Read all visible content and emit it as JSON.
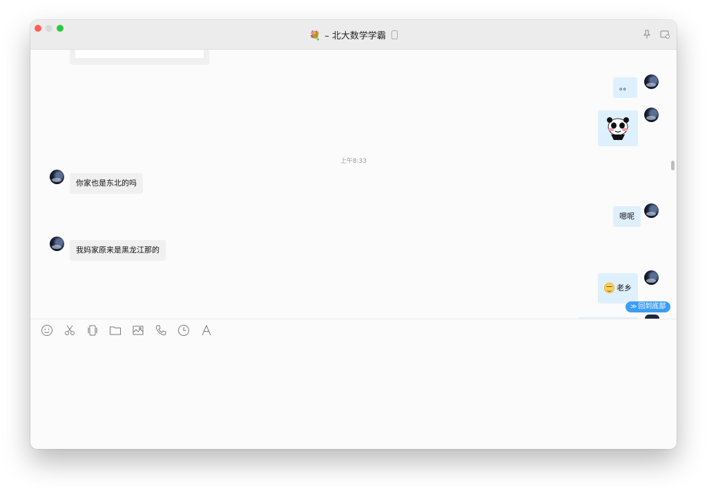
{
  "window": {
    "title_emoji": "💐",
    "title": "– 北大数学学霸"
  },
  "messages": [
    {
      "side": "right",
      "text": "。。"
    },
    {
      "side": "right",
      "type": "sticker",
      "sticker": "panda-sticker"
    },
    {
      "type": "time",
      "text": "上午8:33"
    },
    {
      "side": "left",
      "text": "你家也是东北的吗"
    },
    {
      "side": "right",
      "text": "嗯呢"
    },
    {
      "side": "left",
      "text": "我妈家原来是黑龙江那的"
    },
    {
      "side": "right",
      "emoji": "smile-emoji",
      "text": "老乡"
    }
  ],
  "scroll_to_bottom_label": "回到底部",
  "toolbar": [
    "emoji-icon",
    "scissors-icon",
    "vibrate-icon",
    "folder-icon",
    "image-icon",
    "phone-icon",
    "history-icon",
    "font-icon"
  ],
  "colors": {
    "bubble_self": "#dff0fd",
    "bubble_other": "#f0f0f0",
    "accent": "#3d9df2"
  }
}
